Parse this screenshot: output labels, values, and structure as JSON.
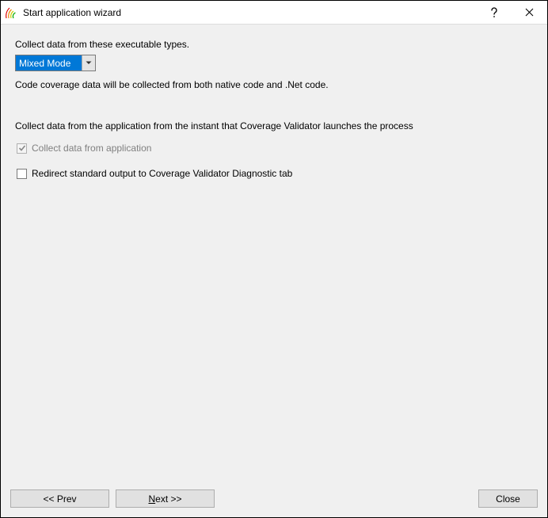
{
  "titlebar": {
    "title": "Start application wizard"
  },
  "executableTypes": {
    "label": "Collect data from these executable types.",
    "selected": "Mixed Mode",
    "description": "Code coverage data will be collected from both native code and .Net code."
  },
  "collectData": {
    "sectionLabel": "Collect data from the application from the instant that Coverage Validator launches the process",
    "checkbox1Label": "Collect data from application",
    "checkbox2Label": "Redirect standard output to Coverage Validator Diagnostic tab"
  },
  "buttons": {
    "prev": "<< Prev",
    "nextPrefix": "N",
    "nextSuffix": "ext >>",
    "close": "Close"
  }
}
